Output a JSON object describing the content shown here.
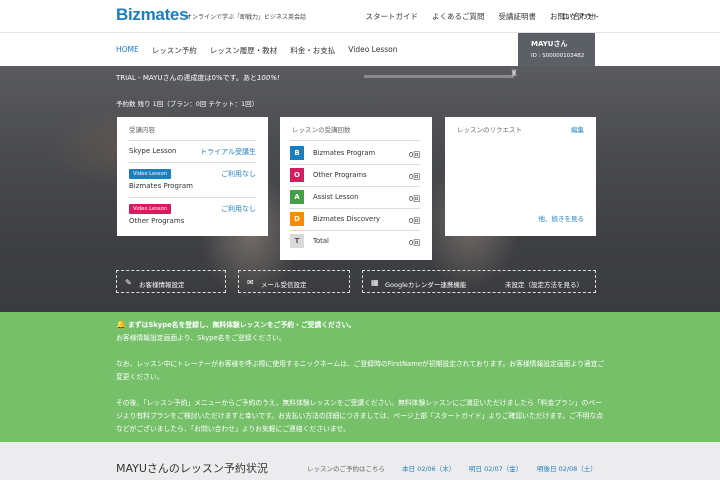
{
  "header": {
    "logo": "Bizmates",
    "tagline": "オンラインで学ぶ「即戦力」ビジネス英会話",
    "links": [
      "スタートガイド",
      "よくあるご質問",
      "受講証明書",
      "お問い合わせ",
      "ログアウト"
    ]
  },
  "nav": {
    "items": [
      "HOME",
      "レッスン予約",
      "レッスン履歴・教材",
      "料金・お支払",
      "Video Lesson"
    ],
    "user_name": "MAYUさん",
    "user_id": "ID : S00000103482"
  },
  "hero": {
    "trial_text": "TRIAL - MAYUさんの達成度は0%です。あと",
    "trial_pct": "100%!",
    "progress_fraction": 0.0,
    "reservation": "予約数 残り 1回（プラン：0回 チケット：1回）"
  },
  "course_card": {
    "title": "受講内容",
    "skype_label": "Skype Lesson",
    "skype_value": "トライアル受講生",
    "video_badge": "Video Lesson",
    "bizmates_program": "Bizmates Program",
    "bizmates_value": "ご利用なし",
    "other_badge": "Video Lesson",
    "other_programs": "Other Programs",
    "other_value": "ご利用なし"
  },
  "count_card": {
    "title": "レッスンの受講回数",
    "rows": [
      {
        "icon": "B",
        "label": "Bizmates Program",
        "count": "0回",
        "color": "#1a7fc1"
      },
      {
        "icon": "O",
        "label": "Other Programs",
        "count": "0回",
        "color": "#d81b60"
      },
      {
        "icon": "A",
        "label": "Assist Lesson",
        "count": "0回",
        "color": "#43a047"
      },
      {
        "icon": "D",
        "label": "Bizmates Discovery",
        "count": "0回",
        "color": "#fb8c00"
      },
      {
        "icon": "T",
        "label": "Total",
        "count": "0回",
        "color": "#d9d9d9"
      }
    ]
  },
  "request_card": {
    "title": "レッスンのリクエスト",
    "edit": "編集",
    "more": "他、続きを見る"
  },
  "settings": {
    "customer": "お客様情報設定",
    "mail": "メール受信設定",
    "calendar": "Googleカレンダー連携機能",
    "calendar_status": "未設定（設定方法を見る）"
  },
  "notice": {
    "line1": "まずはSkype名を登録し、無料体験レッスンをご予約・ご受講ください。",
    "line2": "お客様情報設定画面より、Skype名をご登録ください。",
    "para2": "なお、レッスン中にトレーナーがお客様を呼ぶ際に使用するニックネームは、ご登録時のFirstNameが初期設定されております。お客様情報設定画面より適宜ご変更ください。",
    "para3": "その後、「レッスン予約」メニューからご予約のうえ、無料体験レッスンをご受講ください。無料体験レッスンにご満足いただけましたら「料金プラン」のページより有料プランをご検討いただけますと幸いです。お支払い方法の詳細につきましては、ページ上部「スタートガイド」よりご確認いただけます。ご不明な点などがございましたら、「お問い合わせ」よりお気軽にご連絡くださいませ。"
  },
  "booking": {
    "title": "MAYUさんのレッスン予約状況",
    "sub": "レッスンのご予約はこちら",
    "days": [
      "本日 02/06（木）",
      "明日 02/07（金）",
      "明後日 02/08（土）"
    ]
  }
}
